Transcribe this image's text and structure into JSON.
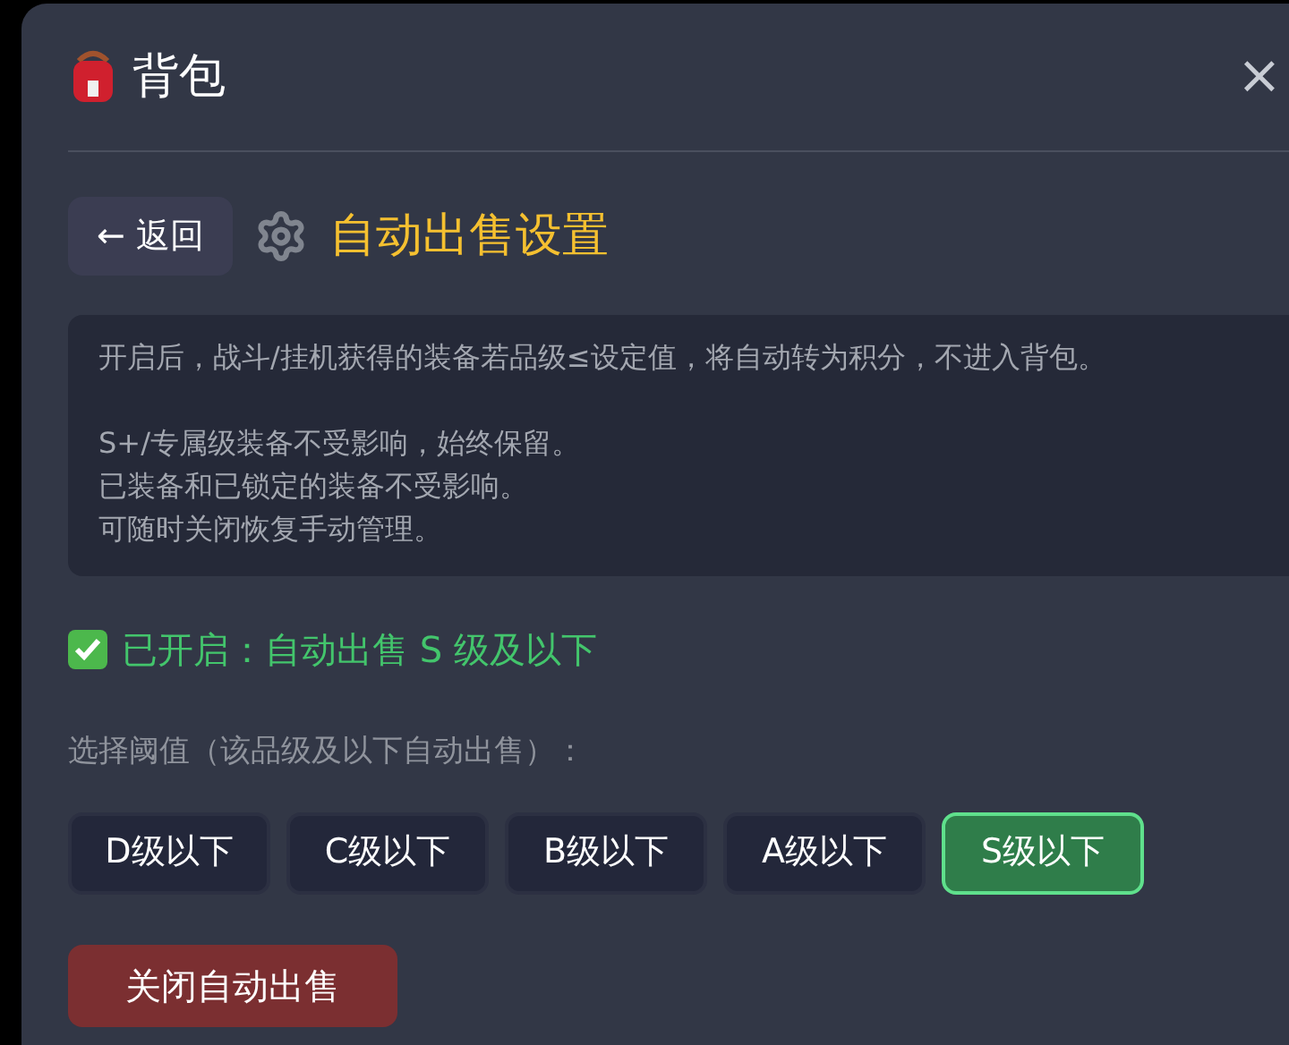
{
  "window": {
    "title": "背包",
    "close": "×"
  },
  "header": {
    "back": "← 返回",
    "title": "自动出售设置"
  },
  "info": {
    "paragraphs": [
      [
        "开启后，战斗/挂机获得的装备若品级≤设定值，将自动转为积分，不进入背包。"
      ],
      [
        "S+/专属级装备不受影响，始终保留。",
        "已装备和已锁定的装备不受影响。",
        "可随时关闭恢复手动管理。"
      ]
    ]
  },
  "status": {
    "enabled": true,
    "text": "已开启：自动出售 S 级及以下"
  },
  "threshold": {
    "label": "选择阈值（该品级及以下自动出售）：",
    "options": [
      {
        "label": "D级以下",
        "selected": false
      },
      {
        "label": "C级以下",
        "selected": false
      },
      {
        "label": "B级以下",
        "selected": false
      },
      {
        "label": "A级以下",
        "selected": false
      },
      {
        "label": "S级以下",
        "selected": true
      }
    ]
  },
  "toggle_button": "关闭自动出售"
}
